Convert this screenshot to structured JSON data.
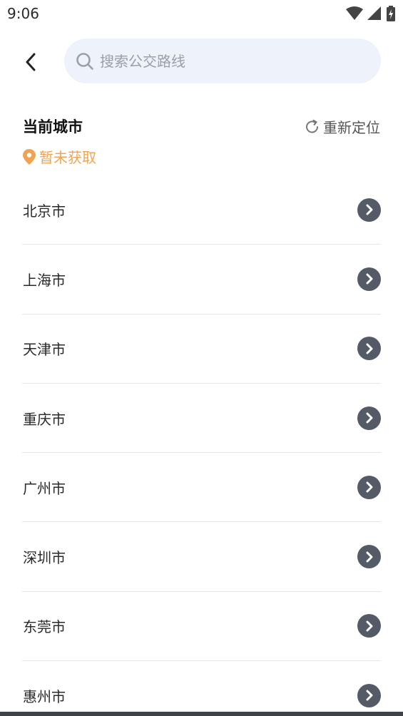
{
  "status_bar": {
    "time": "9:06"
  },
  "search": {
    "placeholder": "搜索公交路线",
    "value": ""
  },
  "current_city": {
    "title": "当前城市",
    "relocate_label": "重新定位",
    "status": "暂未获取",
    "status_color": "#f0a452"
  },
  "cities": [
    {
      "name": "北京市"
    },
    {
      "name": "上海市"
    },
    {
      "name": "天津市"
    },
    {
      "name": "重庆市"
    },
    {
      "name": "广州市"
    },
    {
      "name": "深圳市"
    },
    {
      "name": "东莞市"
    },
    {
      "name": "惠州市"
    }
  ],
  "icons": {
    "back": "chevron-left-icon",
    "search": "search-icon",
    "relocate": "refresh-icon",
    "location": "location-pin-icon",
    "row_arrow": "chevron-right-circle-icon"
  }
}
